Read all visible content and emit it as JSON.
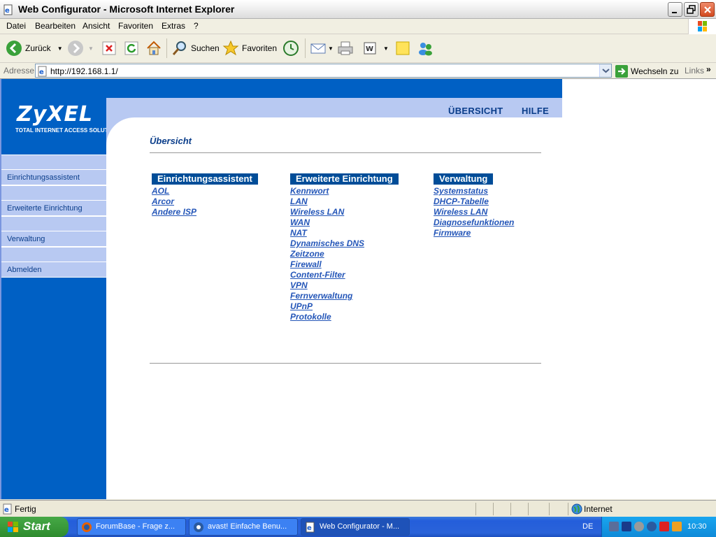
{
  "window": {
    "title": "Web Configurator - Microsoft Internet Explorer"
  },
  "menubar": {
    "items": [
      "Datei",
      "Bearbeiten",
      "Ansicht",
      "Favoriten",
      "Extras",
      "?"
    ]
  },
  "toolbar": {
    "back_label": "Zurück",
    "search_label": "Suchen",
    "favorites_label": "Favoriten"
  },
  "addressbar": {
    "label": "Adresse",
    "url": "http://192.168.1.1/",
    "go_label": "Wechseln zu",
    "links_label": "Links"
  },
  "router": {
    "logo": "ZyXEL",
    "logo_sub": "TOTAL INTERNET ACCESS SOLUTION",
    "nav": {
      "overview": "ÜBERSICHT",
      "help": "HILFE"
    },
    "sidebar": [
      "Einrichtungsassistent",
      "Erweiterte Einrichtung",
      "Verwaltung",
      "Abmelden"
    ],
    "page_title": "Übersicht",
    "columns": [
      {
        "heading": "Einrichtungsassistent",
        "links": [
          "AOL",
          "Arcor",
          "Andere ISP"
        ]
      },
      {
        "heading": "Erweiterte Einrichtung",
        "links": [
          "Kennwort",
          "LAN",
          "Wireless LAN",
          "WAN",
          "NAT",
          "Dynamisches DNS",
          "Zeitzone",
          "Firewall",
          "Content-Filter",
          "VPN",
          "Fernverwaltung",
          "UPnP",
          "Protokolle"
        ]
      },
      {
        "heading": "Verwaltung",
        "links": [
          "Systemstatus",
          "DHCP-Tabelle",
          "Wireless LAN",
          "Diagnosefunktionen",
          "Firmware"
        ]
      }
    ]
  },
  "statusbar": {
    "status": "Fertig",
    "zone": "Internet"
  },
  "taskbar": {
    "start_label": "Start",
    "tasks": [
      "ForumBase - Frage z...",
      "avast! Einfache Benu...",
      "Web Configurator - M..."
    ],
    "language": "DE",
    "clock": "10:30"
  },
  "colors": {
    "zyxel_blue": "#0060c4",
    "nav_light": "#b8c9f2",
    "link": "#2456b8",
    "heading_bg": "#004d98"
  }
}
